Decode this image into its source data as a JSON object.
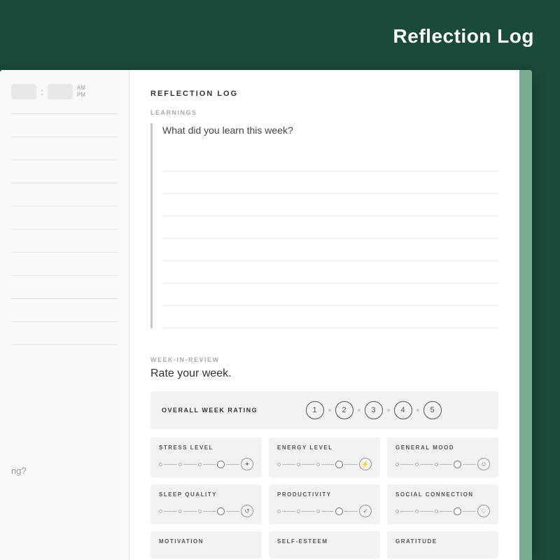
{
  "header": {
    "title": "Reflection Log",
    "background_color": "#1a4a3a"
  },
  "left_panel": {
    "time": {
      "am": "AM",
      "pm": "PM"
    },
    "question": "ng?"
  },
  "reflection_log": {
    "section_title": "REFLECTION LOG",
    "learnings": {
      "label": "LEARNINGS",
      "prompt": "What did you learn this week?"
    },
    "week_in_review": {
      "label": "WEEK-IN-REVIEW",
      "subtitle": "Rate your week.",
      "overall": {
        "label": "OVERALL WEEK RATING",
        "numbers": [
          "1",
          "2",
          "3",
          "4",
          "5"
        ]
      },
      "categories": [
        {
          "label": "STRESS LEVEL",
          "icon": "✦"
        },
        {
          "label": "ENERGY LEVEL",
          "icon": "⚡"
        },
        {
          "label": "GENERAL MOOD",
          "icon": "☺"
        },
        {
          "label": "SLEEP QUALITY",
          "icon": "⟳"
        },
        {
          "label": "PRODUCTIVITY",
          "icon": "✓"
        },
        {
          "label": "SOCIAL CONNECTION",
          "icon": "♡"
        },
        {
          "label": "MOTIVATION",
          "icon": ""
        },
        {
          "label": "SELF-ESTEEM",
          "icon": ""
        },
        {
          "label": "GRATITUDE",
          "icon": ""
        }
      ]
    }
  }
}
